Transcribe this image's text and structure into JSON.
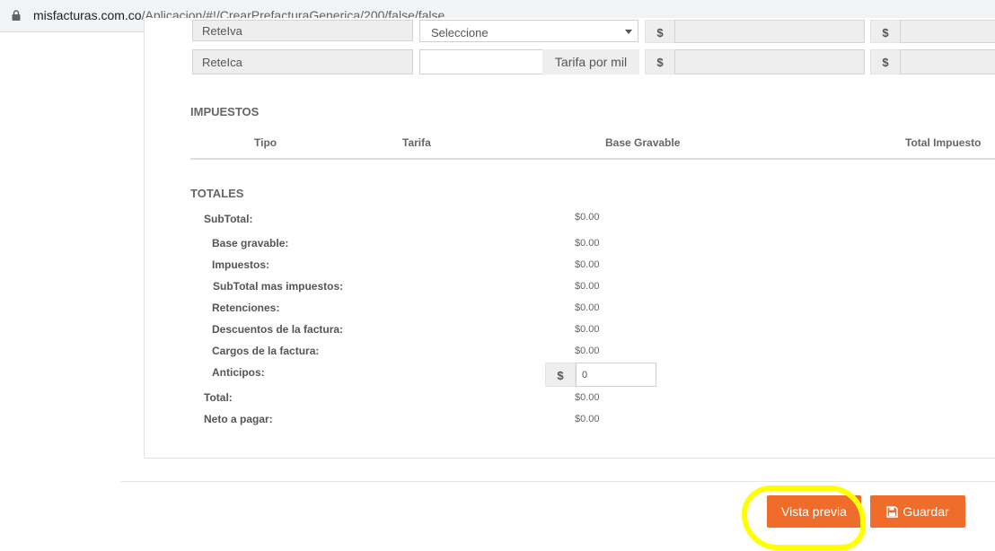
{
  "browser": {
    "url_domain": "misfacturas.com.co",
    "url_path": "/Aplicacion/#!/CrearPrefacturaGenerica/200/false/false"
  },
  "retenciones": {
    "row1": {
      "label": "ReteIva",
      "select_value": "Seleccione",
      "currency1": "$",
      "currency2": "$"
    },
    "row2": {
      "label": "ReteIca",
      "input_value": "",
      "rate_label": "Tarifa por mil",
      "currency1": "$",
      "currency2": "$"
    }
  },
  "impuestos": {
    "title": "IMPUESTOS",
    "columns": [
      "Tipo",
      "Tarifa",
      "Base Gravable",
      "Total Impuesto"
    ]
  },
  "totales": {
    "title": "TOTALES",
    "subtotal_label": "SubTotal:",
    "subtotal_value": "$0.00",
    "rows": [
      {
        "label": "Base gravable:",
        "value": "$0.00"
      },
      {
        "label": "Impuestos:",
        "value": "$0.00"
      },
      {
        "label": "SubTotal mas impuestos:",
        "value": "$0.00"
      },
      {
        "label": "Retenciones:",
        "value": "$0.00"
      },
      {
        "label": "Descuentos de la factura:",
        "value": "$0.00"
      },
      {
        "label": "Cargos de la factura:",
        "value": "$0.00"
      }
    ],
    "anticipos_label": "Anticipos:",
    "anticipos_currency": "$",
    "anticipos_value": "0",
    "total_label": "Total:",
    "total_value": "$0.00",
    "neto_label": "Neto a pagar:",
    "neto_value": "$0.00"
  },
  "actions": {
    "preview_label": "Vista previa",
    "save_label": "Guardar",
    "accent_color": "#ef6c2a",
    "highlight_color": "#ffff00"
  }
}
